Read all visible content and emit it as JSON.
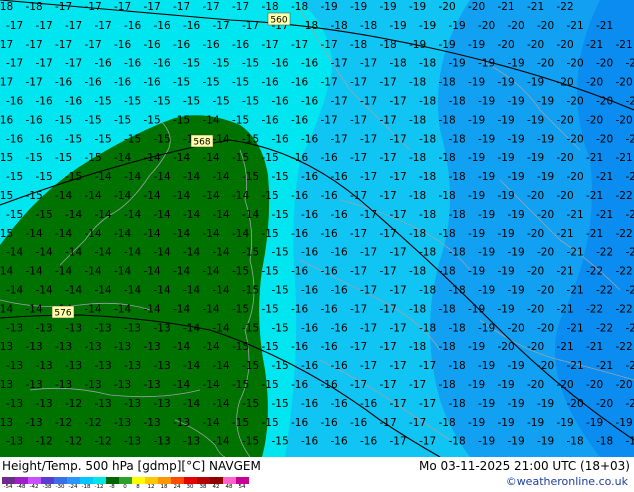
{
  "footer": {
    "title_left": "Height/Temp. 500 hPa [gdmp][°C] NAVGEM",
    "title_right": "Mo 03-11-2025 21:00 UTC (18+03)",
    "credit": "©weatheronline.co.uk"
  },
  "legend": {
    "ticks": [
      "-54",
      "-48",
      "-42",
      "-38",
      "-30",
      "-24",
      "-18",
      "-12",
      "-8",
      "0",
      "8",
      "12",
      "18",
      "24",
      "30",
      "38",
      "42",
      "48",
      "54"
    ],
    "colors": [
      "#6e2b8c",
      "#a020c8",
      "#c850ff",
      "#5a3cd2",
      "#3c6ee6",
      "#2896ff",
      "#00c8ff",
      "#00e6e6",
      "#006400",
      "#2ca02c",
      "#ffff00",
      "#ffc800",
      "#ff9600",
      "#ff4b00",
      "#e60000",
      "#b40000",
      "#8c0000",
      "#ff64c8",
      "#c80096"
    ]
  },
  "map": {
    "region_colors": {
      "green": "#007200",
      "cyan": "#00e6f0",
      "light_blue": "#10c4f4",
      "blue": "#11a0f2",
      "deep_blue": "#0a8cf0"
    },
    "height_labels": [
      "560",
      "568",
      "576"
    ],
    "temperature_rows": [
      "-18 -18 -17 -17 -17 -17 -17 -17 -17 -18 -18 -19 -19 -19 -19 -20 -20 -21 -21 -22",
      "-17 -17 -17 -17 -16 -16 -16 -17 -17 -17 -18 -18 -18 -19 -19 -19 -20 -20 -20 -21 -21",
      "-17 -17 -17 -17 -16 -16 -16 -16 -16 -17 -17 -17 -18 -18 -19 -19 -19 -20 -20 -20 -21 -21",
      "-17 -17 -17 -16 -16 -16 -15 -15 -15 -16 -16 -17 -17 -18 -18 -19 -19 -19 -20 -20 -20 -21",
      "-17 -17 -16 -16 -16 -16 -15 -15 -15 -16 -16 -17 -17 -17 -18 -18 -19 -19 -19 -20 -20 -20",
      "-16 -16 -16 -15 -15 -15 -15 -15 -15 -16 -16 -17 -17 -17 -18 -18 -19 -19 -19 -20 -20 -20",
      "-16 -16 -15 -15 -15 -15 -15 -14 -15 -16 -16 -17 -17 -17 -18 -18 -19 -19 -19 -20 -20 -20",
      "-16 -16 -15 -15 -15 -15 -14 -14 -15 -16 -16 -17 -17 -17 -18 -18 -19 -19 -19 -20 -20 -21",
      "-15 -15 -15 -15 -14 -14 -14 -14 -15 -15 -16 -16 -17 -17 -18 -18 -19 -19 -19 -20 -21 -21",
      "-15 -15 -15 -14 -14 -14 -14 -14 -15 -15 -16 -16 -17 -17 -18 -18 -19 -19 -19 -20 -21 -21",
      "-15 -15 -14 -14 -14 -14 -14 -14 -14 -15 -16 -16 -17 -17 -18 -18 -19 -19 -20 -20 -21 -22",
      "-15 -15 -14 -14 -14 -14 -14 -14 -14 -15 -16 -16 -17 -17 -18 -18 -19 -19 -20 -21 -21 -22",
      "-15 -14 -14 -14 -14 -14 -14 -14 -14 -15 -16 -16 -17 -17 -18 -18 -19 -19 -20 -21 -21 -22",
      "-14 -14 -14 -14 -14 -14 -14 -14 -15 -15 -16 -16 -17 -17 -18 -18 -19 -19 -20 -21 -22 -22",
      "-14 -14 -14 -14 -14 -14 -14 -14 -15 -15 -16 -16 -17 -17 -18 -18 -19 -19 -20 -21 -22 -22",
      "-14 -14 -14 -14 -14 -14 -14 -14 -15 -15 -16 -16 -17 -17 -18 -18 -19 -19 -20 -21 -22 -22",
      "-14 -14 -14 -14 -14 -14 -14 -14 -15 -15 -16 -16 -17 -17 -18 -18 -19 -19 -20 -21 -22 -22",
      "-13 -13 -13 -13 -13 -13 -14 -14 -15 -15 -16 -16 -17 -17 -18 -18 -19 -20 -20 -21 -22 -22",
      "-13 -13 -13 -13 -13 -13 -14 -14 -15 -15 -16 -16 -17 -17 -18 -18 -19 -20 -20 -21 -21 -22",
      "-13 -13 -13 -13 -13 -13 -14 -14 -15 -15 -16 -16 -17 -17 -17 -18 -19 -19 -20 -21 -21 -21",
      "-13 -13 -13 -13 -13 -13 -14 -14 -15 -15 -16 -16 -17 -17 -17 -18 -19 -19 -20 -20 -20 -20",
      "-13 -13 -12 -13 -13 -13 -14 -14 -15 -15 -16 -16 -16 -17 -17 -18 -19 -19 -19 -20 -20 -20",
      "-13 -13 -12 -12 -13 -13 -13 -14 -15 -15 -16 -16 -16 -17 -17 -18 -19 -19 -19 -19 -19 -19",
      "-13 -12 -12 -12 -13 -13 -13 -14 -15 -15 -16 -16 -16 -17 -17 -18 -19 -19 -19 -18 -18 -18",
      "-13 -12 -12 -12 -12 -13 -13 -14 -15 -15 -16 -16 -16 -17 -17 -18 -18 -19 -18 -18 -18 -18"
    ]
  }
}
